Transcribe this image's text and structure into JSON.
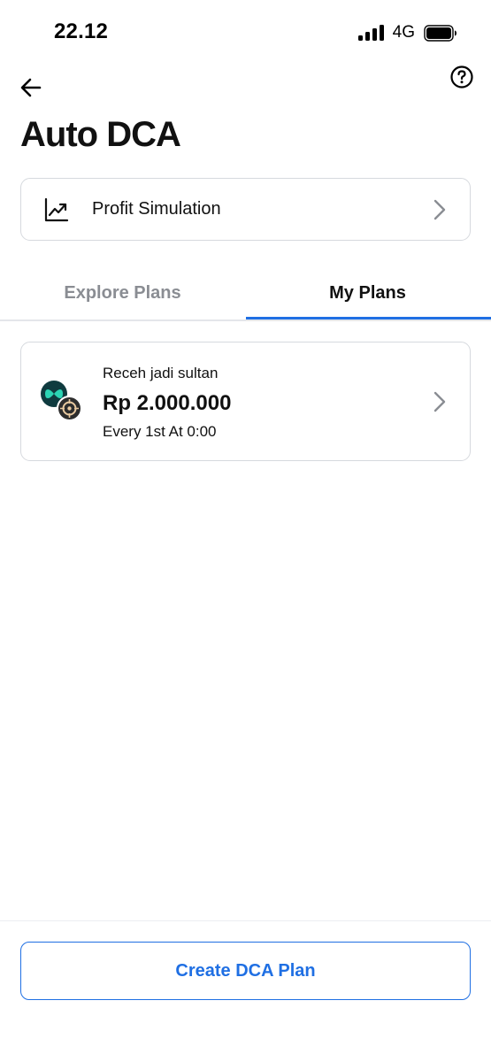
{
  "status_bar": {
    "time": "22.12",
    "network": "4G",
    "signal_icon": "signal-bars-icon",
    "battery_icon": "battery-full-icon"
  },
  "header": {
    "back_icon": "arrow-left-icon",
    "help_icon": "question-circle-icon",
    "title": "Auto DCA"
  },
  "simulation_card": {
    "icon": "trending-up-chart-icon",
    "label": "Profit Simulation",
    "chevron_icon": "chevron-right-icon"
  },
  "tabs": [
    {
      "label": "Explore Plans",
      "active": false
    },
    {
      "label": "My Plans",
      "active": true
    }
  ],
  "plans": [
    {
      "name": "Receh jadi sultan",
      "amount": "Rp 2.000.000",
      "schedule": "Every 1st At 0:00",
      "coin_icons": [
        "teal-coin-icon",
        "dark-coin-icon"
      ],
      "chevron_icon": "chevron-right-icon"
    }
  ],
  "create_button": {
    "label": "Create DCA Plan"
  },
  "colors": {
    "accent": "#1f6fe3",
    "text_primary": "#111111",
    "text_muted": "#8a8d93",
    "border": "#d6d9de",
    "coin_teal": "#2bd4b4"
  }
}
